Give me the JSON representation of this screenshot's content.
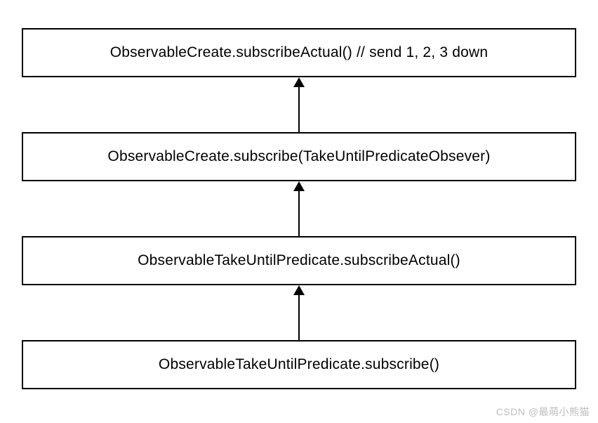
{
  "diagram": {
    "boxes": [
      {
        "label": "ObservableCreate.subscribeActual() // send 1, 2, 3 down"
      },
      {
        "label": "ObservableCreate.subscribe(TakeUntilPredicateObsever)"
      },
      {
        "label": "ObservableTakeUntilPredicate.subscribeActual()"
      },
      {
        "label": "ObservableTakeUntilPredicate.subscribe()"
      }
    ]
  },
  "watermark": "CSDN @最萌小熊猫"
}
